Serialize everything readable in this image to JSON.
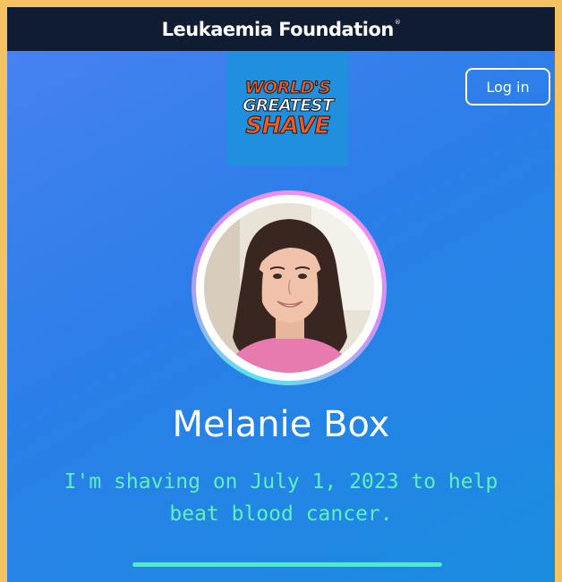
{
  "header": {
    "brand": "Leukaemia Foundation",
    "brand_mark": "®"
  },
  "logo": {
    "line1": "WORLD'S",
    "line2": "GREATEST",
    "line3": "SHAVE",
    "accent_color": "#f15a22"
  },
  "login_label": "Log in",
  "profile": {
    "name": "Melanie Box",
    "tagline": "I'm shaving on July 1, 2023 to help beat blood cancer."
  },
  "progress": {
    "fraction": 1.0
  },
  "colors": {
    "header_bg": "#0f1c31",
    "accent_green": "#5ef2ba",
    "page_frame": "#f3c262"
  },
  "icons": {
    "avatar": "profile-photo"
  }
}
